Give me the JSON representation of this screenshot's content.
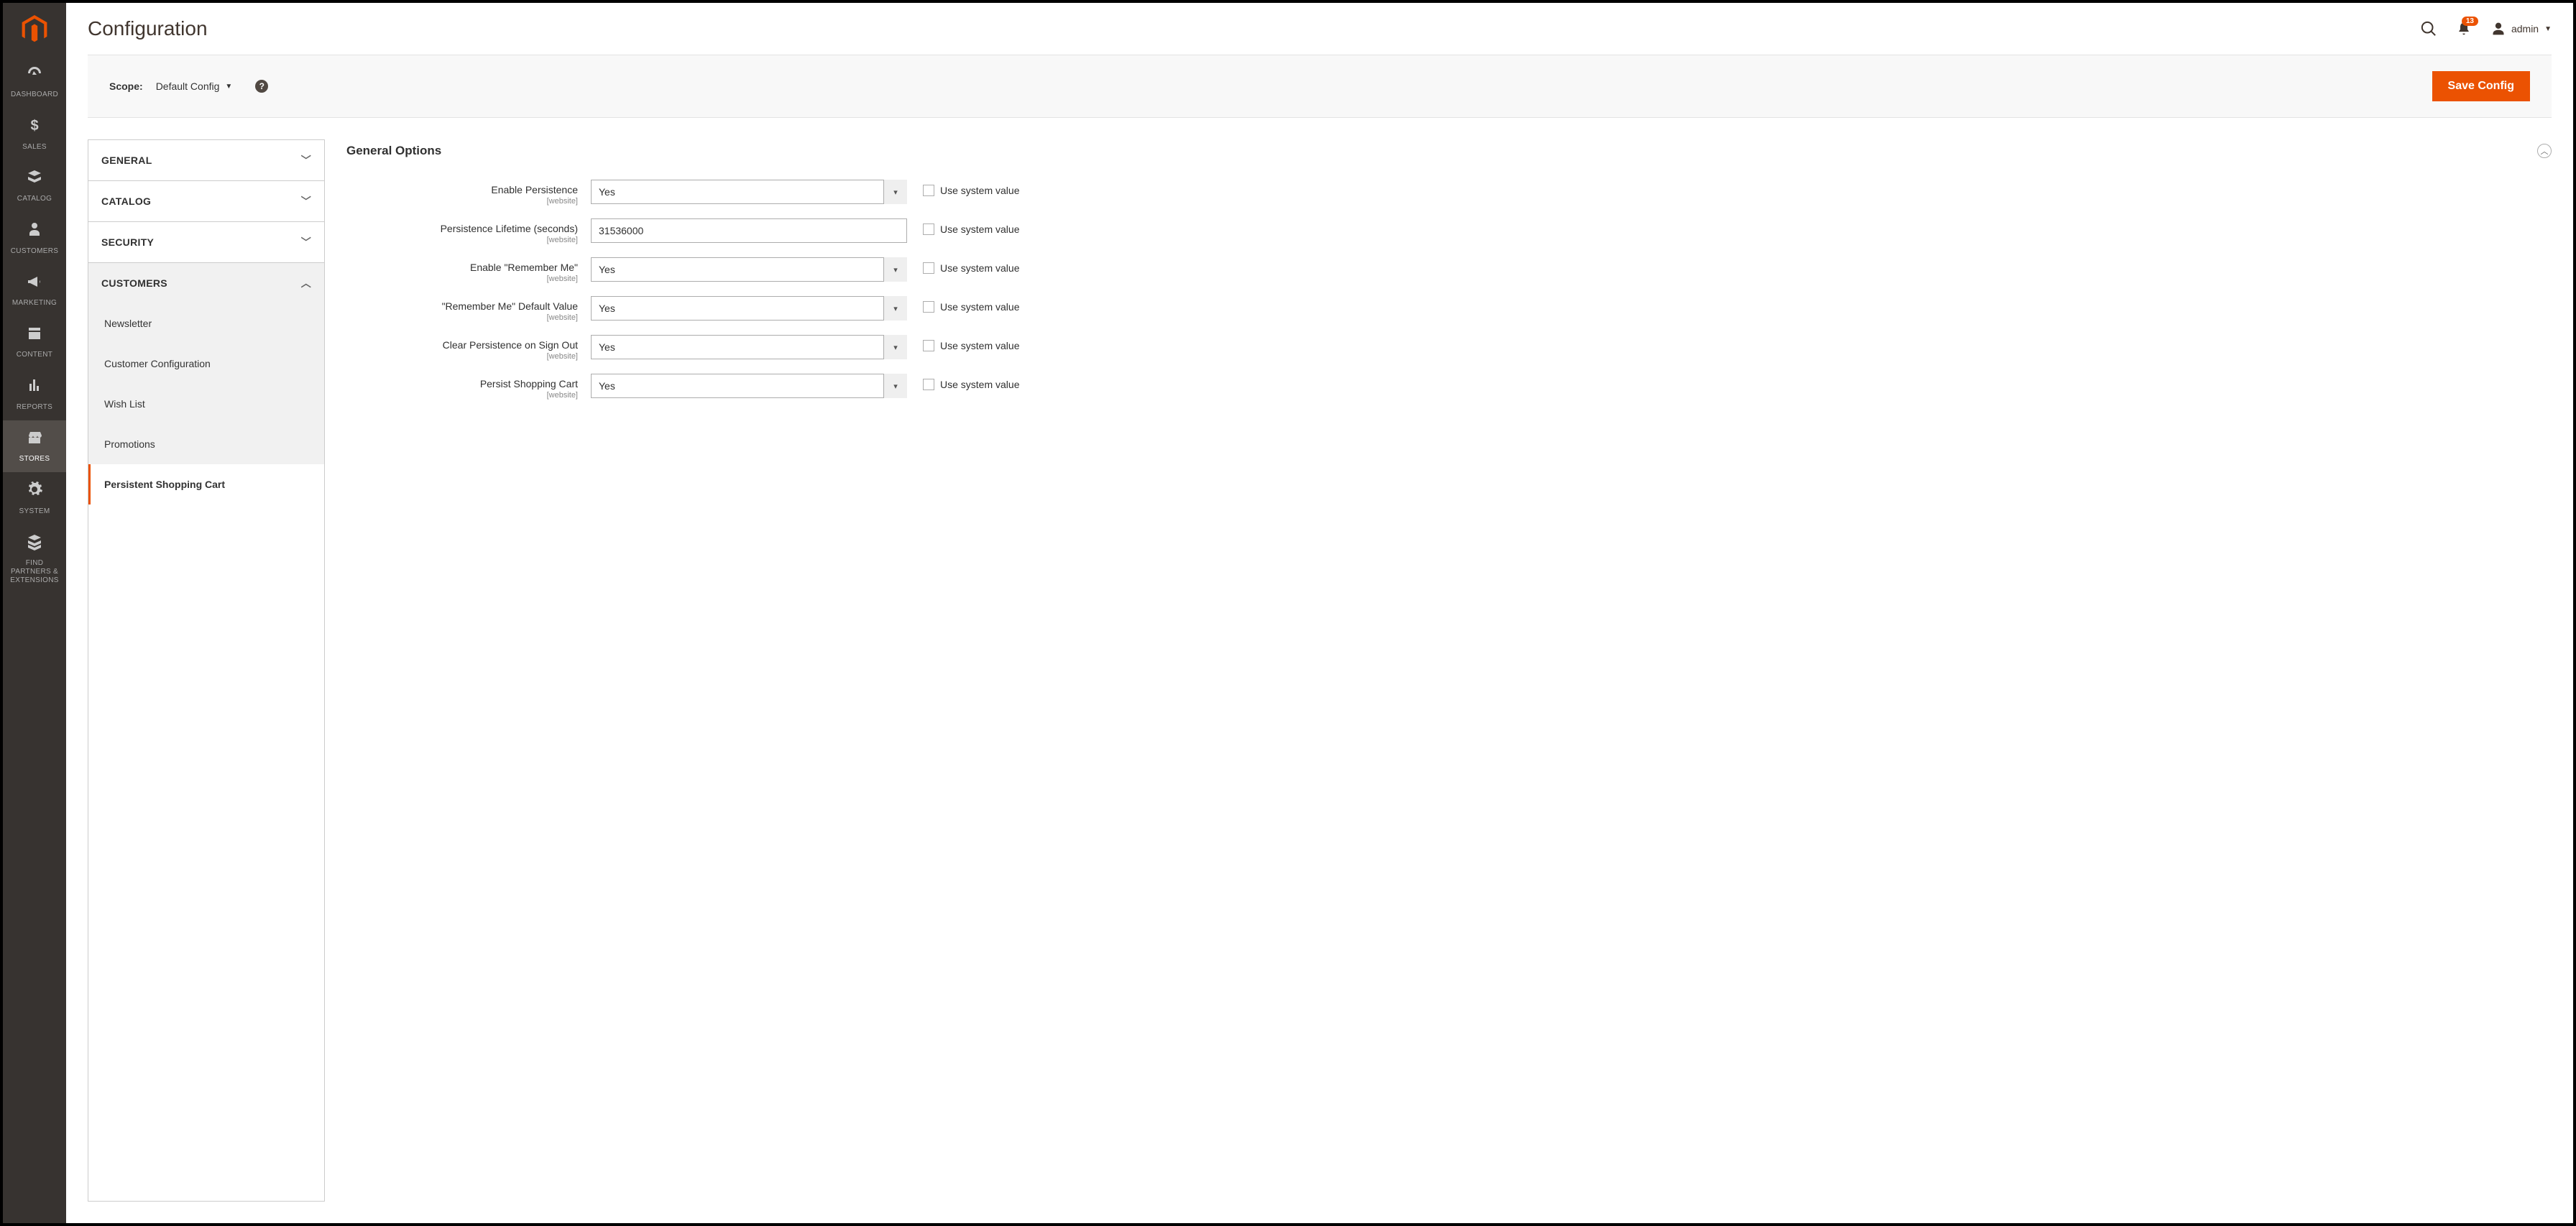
{
  "page_title": "Configuration",
  "header": {
    "notification_count": "13",
    "user_label": "admin"
  },
  "scope": {
    "label": "Scope:",
    "value": "Default Config",
    "save_button": "Save Config"
  },
  "sidebar_nav": [
    {
      "label": "DASHBOARD",
      "icon": "dashboard"
    },
    {
      "label": "SALES",
      "icon": "dollar"
    },
    {
      "label": "CATALOG",
      "icon": "catalog"
    },
    {
      "label": "CUSTOMERS",
      "icon": "person"
    },
    {
      "label": "MARKETING",
      "icon": "bullhorn"
    },
    {
      "label": "CONTENT",
      "icon": "content"
    },
    {
      "label": "REPORTS",
      "icon": "reports"
    },
    {
      "label": "STORES",
      "icon": "stores",
      "active": true
    },
    {
      "label": "SYSTEM",
      "icon": "gear"
    },
    {
      "label": "FIND PARTNERS & EXTENSIONS",
      "icon": "partners"
    }
  ],
  "config_nav": {
    "sections": [
      {
        "label": "GENERAL",
        "expanded": false
      },
      {
        "label": "CATALOG",
        "expanded": false
      },
      {
        "label": "SECURITY",
        "expanded": false
      },
      {
        "label": "CUSTOMERS",
        "expanded": true,
        "items": [
          {
            "label": "Newsletter"
          },
          {
            "label": "Customer Configuration"
          },
          {
            "label": "Wish List"
          },
          {
            "label": "Promotions"
          },
          {
            "label": "Persistent Shopping Cart",
            "active": true
          }
        ]
      }
    ]
  },
  "form": {
    "section_title": "General Options",
    "scope_note": "[website]",
    "use_system_label": "Use system value",
    "fields": [
      {
        "label": "Enable Persistence",
        "type": "select",
        "value": "Yes"
      },
      {
        "label": "Persistence Lifetime (seconds)",
        "type": "text",
        "value": "31536000"
      },
      {
        "label": "Enable \"Remember Me\"",
        "type": "select",
        "value": "Yes"
      },
      {
        "label": "\"Remember Me\" Default Value",
        "type": "select",
        "value": "Yes"
      },
      {
        "label": "Clear Persistence on Sign Out",
        "type": "select",
        "value": "Yes"
      },
      {
        "label": "Persist Shopping Cart",
        "type": "select",
        "value": "Yes"
      }
    ]
  }
}
